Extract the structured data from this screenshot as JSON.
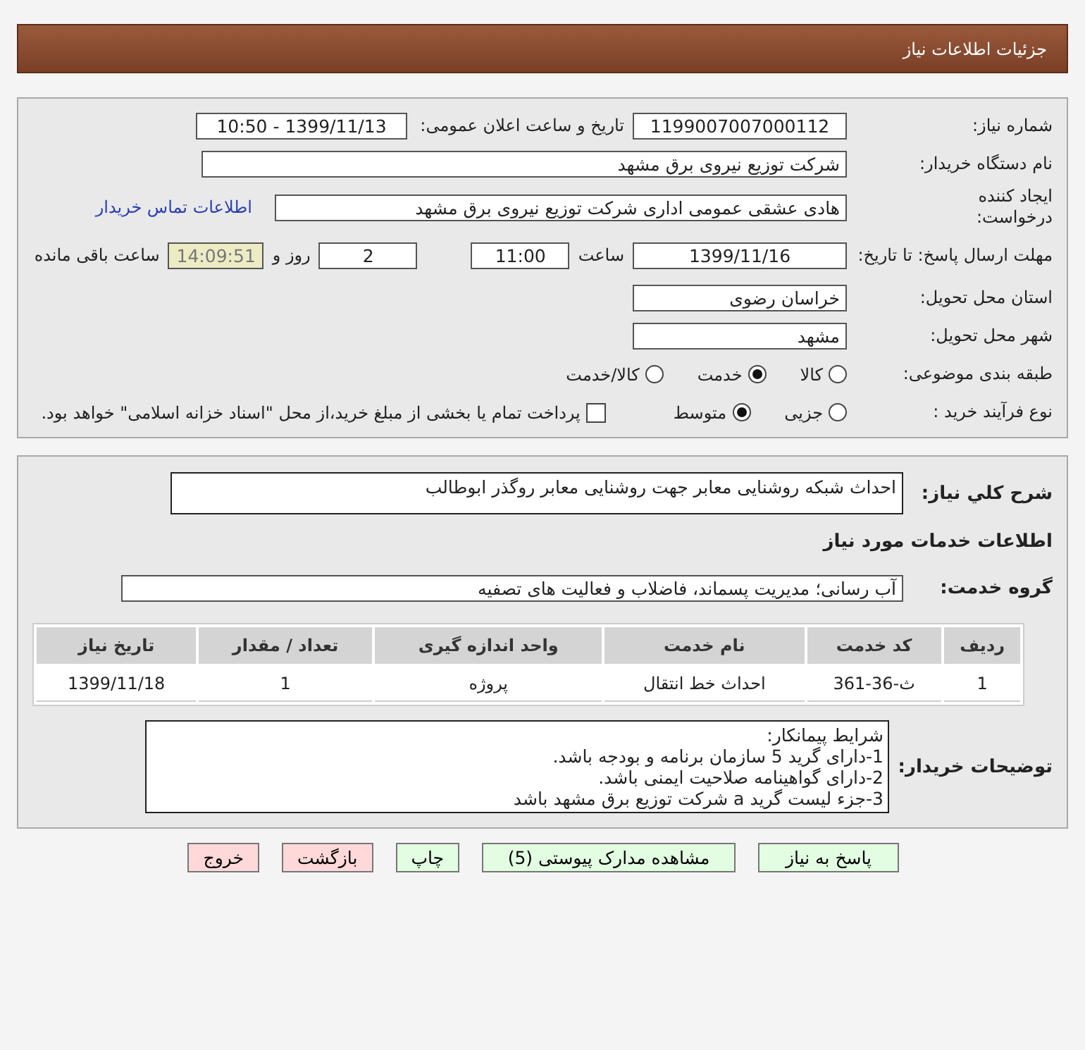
{
  "header": {
    "title": "جزئیات اطلاعات نیاز"
  },
  "details": {
    "need_number": {
      "label": "شماره نیاز:",
      "value": "1199007007000112"
    },
    "announce": {
      "label": "تاریخ و ساعت اعلان عمومی:",
      "value": "1399/11/13 - 10:50"
    },
    "buyer_org": {
      "label": "نام دستگاه خریدار:",
      "value": "شرکت توزیع نیروی برق مشهد"
    },
    "requester": {
      "label": "ایجاد کننده درخواست:",
      "value": "هادی عشقی عمومی اداری شرکت توزیع نیروی برق مشهد",
      "link": "اطلاعات تماس خریدار"
    },
    "deadline": {
      "label": "مهلت ارسال پاسخ: تا تاریخ:",
      "date": "1399/11/16",
      "time_label": "ساعت",
      "time": "11:00",
      "days": "2",
      "days_label": "روز و",
      "remaining": "14:09:51",
      "remaining_label": "ساعت باقی مانده"
    },
    "province": {
      "label": "استان محل تحویل:",
      "value": "خراسان رضوی"
    },
    "city": {
      "label": "شهر محل تحویل:",
      "value": "مشهد"
    },
    "category": {
      "label": "طبقه بندی موضوعی:",
      "options": [
        {
          "label": "کالا",
          "selected": false
        },
        {
          "label": "خدمت",
          "selected": true
        },
        {
          "label": "کالا/خدمت",
          "selected": false
        }
      ]
    },
    "purchase_type": {
      "label": "نوع فرآیند خرید :",
      "options": [
        {
          "label": "جزیی",
          "selected": false
        },
        {
          "label": "متوسط",
          "selected": true
        }
      ],
      "payment": {
        "label": "پرداخت تمام یا بخشی از مبلغ خرید،از محل \"اسناد خزانه اسلامی\" خواهد بود.",
        "checked": false
      }
    }
  },
  "description": {
    "label": "شرح کلي نياز:",
    "value": "احداث شبکه روشنایی معابر جهت روشنایی معابر روگذر ابوطالب"
  },
  "services_title": "اطلاعات خدمات مورد نیاز",
  "service_group": {
    "label": "گروه خدمت:",
    "value": "آب رسانی؛ مدیریت پسماند، فاضلاب و فعالیت های تصفیه"
  },
  "table": {
    "columns": [
      "ردیف",
      "کد خدمت",
      "نام خدمت",
      "واحد اندازه گیری",
      "تعداد / مقدار",
      "تاریخ نیاز"
    ],
    "rows": [
      [
        "1",
        "ث-36-361",
        "احداث خط انتقال",
        "پروژه",
        "1",
        "1399/11/18"
      ]
    ]
  },
  "buyer_notes": {
    "label": "توضیحات خریدار:",
    "lines": [
      "شرایط پیمانکار:",
      "1-دارای گرید 5 سازمان برنامه و بودجه باشد.",
      "2-دارای گواهینامه صلاحیت ایمنی باشد.",
      "3-جزء لیست گرید a شرکت توزیع برق مشهد باشد"
    ]
  },
  "buttons": [
    {
      "label": "پاسخ به نیاز",
      "kind": "green"
    },
    {
      "label": "مشاهده مدارک پیوستی (5)",
      "kind": "green"
    },
    {
      "label": "چاپ",
      "kind": "green"
    },
    {
      "label": "بازگشت",
      "kind": "pink"
    },
    {
      "label": "خروج",
      "kind": "pink"
    }
  ]
}
